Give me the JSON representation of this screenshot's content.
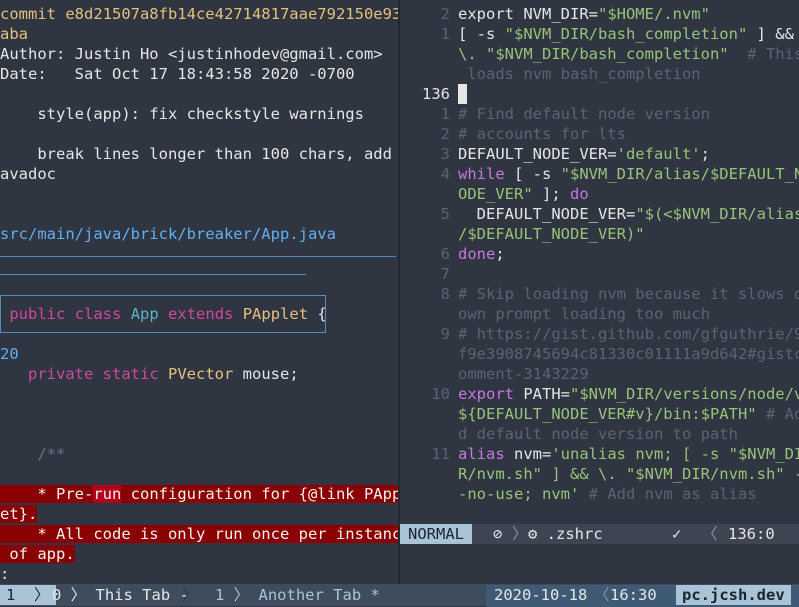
{
  "left_pane": {
    "commit_line": "commit e8d21507a8fb14ce42714817aae792150e935",
    "commit_wrap": "aba",
    "author": "Author: Justin Ho <justinhodev@gmail.com>",
    "date": "Date:   Sat Oct 17 18:43:58 2020 -0700",
    "subject": "    style(app): fix checkstyle warnings",
    "body1": "    break lines longer than 100 chars, add j",
    "body2": "avadoc",
    "file_path": "src/main/java/brick/breaker/App.java",
    "hunk_kw1": "public",
    "hunk_kw2": "class",
    "hunk_cls": "App",
    "hunk_kw3": "extends",
    "hunk_type": "PApplet",
    "hunk_brace": " {",
    "line_num": "20",
    "field_kw1": "private",
    "field_kw2": "static",
    "field_type": "PVector",
    "field_name": " mouse;",
    "javadoc_open": "    /**",
    "del1a": "    * Pre-",
    "del1b": "run",
    "del1c": " configuration for {@link PAppl",
    "del2": "et}.",
    "del3": "    * All code is only run once per instance",
    "del4": " of app.",
    "prompt": ":"
  },
  "right_pane": {
    "lines": [
      {
        "n": "2",
        "t": [
          [
            "w",
            "export NVM_DIR="
          ],
          [
            "str",
            "\"$HOME/.nvm\""
          ]
        ]
      },
      {
        "n": "1",
        "t": [
          [
            "w",
            "[ -s "
          ],
          [
            "str",
            "\"$NVM_DIR/bash_completion\""
          ],
          [
            "w",
            " ] &&"
          ]
        ]
      },
      {
        "n": "",
        "t": [
          [
            "str",
            "\\. \"$NVM_DIR/bash_completion\""
          ],
          [
            "cmt",
            "  # This"
          ]
        ]
      },
      {
        "n": "",
        "t": [
          [
            "cmt",
            " loads nvm bash_completion"
          ]
        ]
      },
      {
        "n": "136",
        "cur": true,
        "t": []
      },
      {
        "n": "1",
        "t": [
          [
            "cmt",
            "# Find default node version"
          ]
        ]
      },
      {
        "n": "2",
        "t": [
          [
            "cmt",
            "# accounts for lts"
          ]
        ]
      },
      {
        "n": "3",
        "t": [
          [
            "w",
            "DEFAULT_NODE_VER="
          ],
          [
            "str",
            "'default'"
          ],
          [
            "w",
            ";"
          ]
        ]
      },
      {
        "n": "4",
        "t": [
          [
            "kw2",
            "while"
          ],
          [
            "w",
            " [ -s "
          ],
          [
            "str",
            "\"$NVM_DIR/alias/$DEFAULT_N"
          ]
        ]
      },
      {
        "n": "",
        "t": [
          [
            "str",
            "ODE_VER\""
          ],
          [
            "w",
            " ]; "
          ],
          [
            "kw2",
            "do"
          ]
        ]
      },
      {
        "n": "5",
        "t": [
          [
            "w",
            "  DEFAULT_NODE_VER="
          ],
          [
            "str",
            "\"$(<$NVM_DIR/alias"
          ]
        ]
      },
      {
        "n": "",
        "t": [
          [
            "str",
            "/$DEFAULT_NODE_VER)\""
          ]
        ]
      },
      {
        "n": "6",
        "t": [
          [
            "kw2",
            "done"
          ],
          [
            "w",
            ";"
          ]
        ]
      },
      {
        "n": "7",
        "t": []
      },
      {
        "n": "8",
        "t": [
          [
            "cmt",
            "# Skip loading nvm because it slows d"
          ]
        ]
      },
      {
        "n": "",
        "t": [
          [
            "cmt",
            "own prompt loading too much"
          ]
        ]
      },
      {
        "n": "9",
        "t": [
          [
            "cmt",
            "# https://gist.github.com/gfguthrie/9"
          ]
        ]
      },
      {
        "n": "",
        "t": [
          [
            "cmt",
            "f9e3908745694c81330c01111a9d642#gistc"
          ]
        ]
      },
      {
        "n": "",
        "t": [
          [
            "cmt",
            "omment-3143229"
          ]
        ]
      },
      {
        "n": "10",
        "t": [
          [
            "kw2",
            "export"
          ],
          [
            "w",
            " PATH="
          ],
          [
            "str",
            "\"$NVM_DIR/versions/node/v"
          ]
        ]
      },
      {
        "n": "",
        "t": [
          [
            "str",
            "${DEFAULT_NODE_VER#v}/bin:$PATH\""
          ],
          [
            "cmt",
            " # Ad"
          ]
        ]
      },
      {
        "n": "",
        "t": [
          [
            "cmt",
            "d default node version to path"
          ]
        ]
      },
      {
        "n": "11",
        "t": [
          [
            "kw2",
            "alias"
          ],
          [
            "w",
            " nvm="
          ],
          [
            "str",
            "'unalias nvm; [ -s \"$NVM_DI"
          ]
        ]
      },
      {
        "n": "",
        "t": [
          [
            "str",
            "R/nvm.sh\" ] && \\. \"$NVM_DIR/nvm.sh\" -"
          ]
        ]
      },
      {
        "n": "",
        "t": [
          [
            "str",
            "-no-use; nvm'"
          ],
          [
            "cmt",
            " # Add nvm as alias"
          ]
        ]
      }
    ]
  },
  "vim_status": {
    "mode": "NORMAL",
    "icon1": "⊘",
    "file": "⚙ .zshrc",
    "check": "✓",
    "position": "136:0"
  },
  "tmux": {
    "session": "1",
    "window0_index": "0",
    "window0_name": "This Tab -",
    "window1_index": "1",
    "window1_name": "Another Tab *",
    "date": "2020-10-18",
    "time": "16:30",
    "host": "pc.jcsh.dev"
  }
}
